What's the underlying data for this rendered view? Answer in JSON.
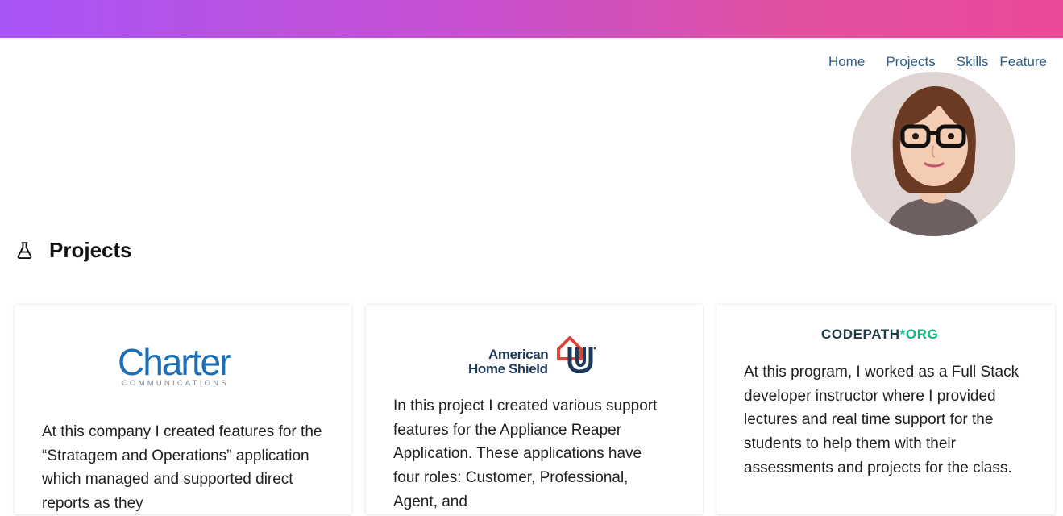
{
  "nav": {
    "items": [
      "Home",
      "Projects",
      "Skills",
      "Feature"
    ]
  },
  "section": {
    "title": "Projects",
    "icon": "flask-icon"
  },
  "cards": [
    {
      "logo_text": "Charter",
      "logo_sub": "COMMUNICATIONS",
      "description": "At this company I created features for the “Stratagem and Operations” application which managed and supported direct reports as they"
    },
    {
      "logo_text_line1": "American",
      "logo_text_line2": "Home Shield",
      "description": "In this project I created various support features for the Appliance Reaper Application. These applications have four roles: Customer, Professional, Agent, and"
    },
    {
      "logo_cp": "CODEPATH",
      "logo_star": "*",
      "logo_org": "ORG",
      "description": "At this program, I worked as a Full Stack developer instructor where I provided lectures and real time support for the students to help them with their assessments and projects for the class."
    }
  ],
  "colors": {
    "gradient_start": "#a855f7",
    "gradient_end": "#ec4899",
    "nav_link": "#2f5d8a",
    "charter_blue": "#1c6fb5",
    "codepath_green": "#10b981"
  }
}
